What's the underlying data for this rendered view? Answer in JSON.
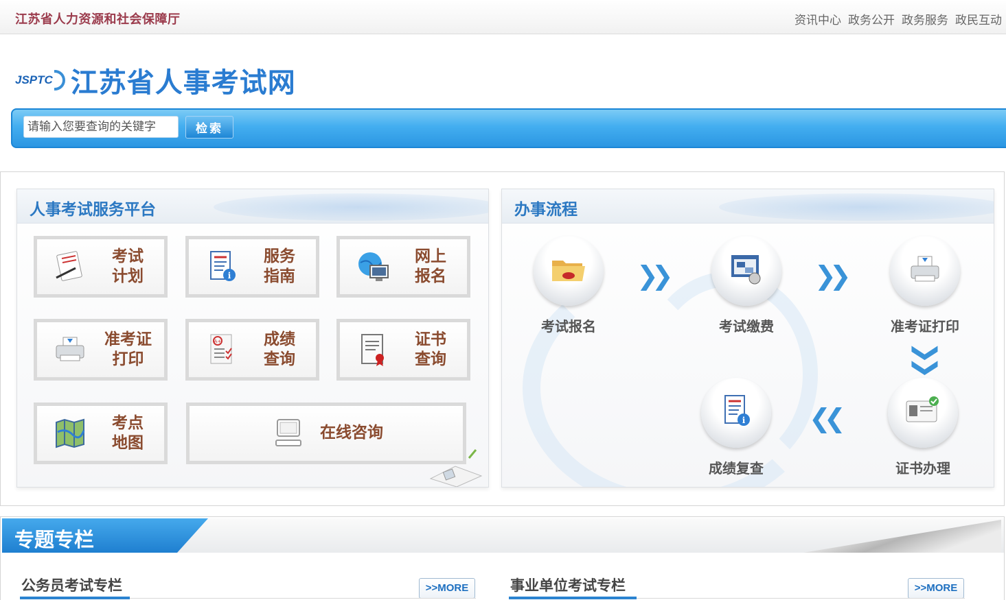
{
  "header": {
    "org_name": "江苏省人力资源和社会保障厅",
    "nav": [
      "资讯中心",
      "政务公开",
      "政务服务",
      "政民互动"
    ]
  },
  "logo": {
    "abbr": "JSPTC",
    "site_name": "江苏省人事考试网"
  },
  "search": {
    "placeholder": "请输入您要查询的关键字",
    "button_label": "检索"
  },
  "service_platform": {
    "title": "人事考试服务平台",
    "tiles": [
      {
        "line1": "考试",
        "line2": "计划",
        "icon": "document-pen-icon"
      },
      {
        "line1": "服务",
        "line2": "指南",
        "icon": "info-document-icon"
      },
      {
        "line1": "网上",
        "line2": "报名",
        "icon": "globe-computer-icon"
      },
      {
        "line1": "准考证",
        "line2": "打印",
        "icon": "printer-icon"
      },
      {
        "line1": "成绩",
        "line2": "查询",
        "icon": "grade-checklist-icon"
      },
      {
        "line1": "证书",
        "line2": "查询",
        "icon": "certificate-icon"
      },
      {
        "line1": "考点",
        "line2": "地图",
        "icon": "map-icon"
      }
    ],
    "consult": {
      "label": "在线咨询",
      "icon": "computer-icon"
    }
  },
  "process": {
    "title": "办事流程",
    "steps": [
      {
        "label": "考试报名",
        "icon": "folder-icon"
      },
      {
        "label": "考试缴费",
        "icon": "payment-screen-icon"
      },
      {
        "label": "准考证打印",
        "icon": "printer-icon"
      },
      {
        "label": "证书办理",
        "icon": "id-card-icon"
      },
      {
        "label": "成绩复查",
        "icon": "info-document-icon"
      }
    ]
  },
  "topics": {
    "title": "专题专栏",
    "columns": [
      {
        "title": "公务员考试专栏",
        "more_label": ">>MORE"
      },
      {
        "title": "事业单位考试专栏",
        "more_label": ">>MORE"
      }
    ]
  }
}
